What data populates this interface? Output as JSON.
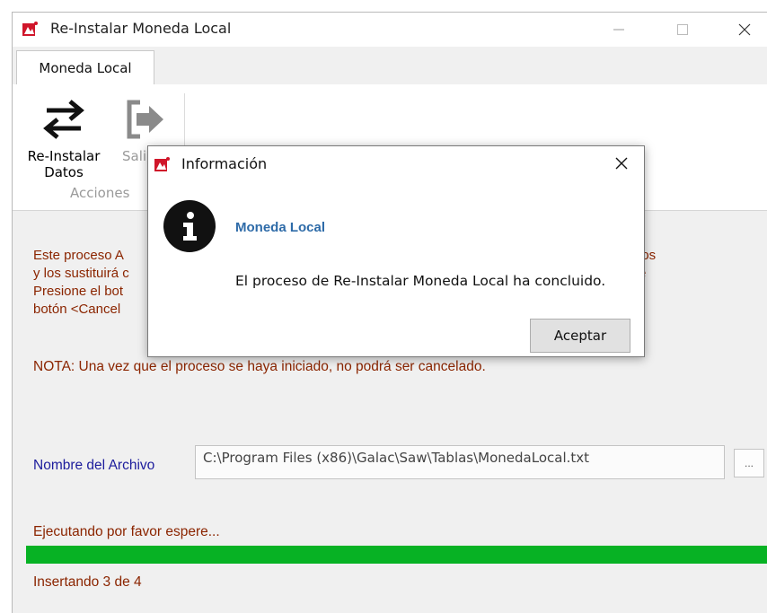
{
  "window": {
    "title": "Re-Instalar Moneda Local",
    "minimize_glyph": "—",
    "maximize_glyph": "☐",
    "close_glyph": "✕"
  },
  "tabs": [
    {
      "label": "Moneda Local",
      "active": true
    }
  ],
  "ribbon": {
    "buttons": [
      {
        "label_line1": "Re-Instalar",
        "label_line2": "Datos",
        "icon": "swap-arrows-icon",
        "enabled": true
      },
      {
        "label_line1": "Salir",
        "icon": "exit-icon",
        "enabled": false
      }
    ],
    "group_label": "Acciones"
  },
  "main": {
    "info_lines": [
      "Este proceso A",
      "y los sustituirá c",
      "Presione el bot",
      "botón <Cancel"
    ],
    "info_lines_right": [
      "dos",
      "re"
    ],
    "nota": "NOTA: Una vez que el proceso se haya iniciado, no podrá ser cancelado.",
    "file_label": "Nombre del Archivo",
    "file_value": "C:\\Program Files (x86)\\Galac\\Saw\\Tablas\\MonedaLocal.txt",
    "browse_label": "...",
    "status_text": "Ejecutando por favor espere...",
    "progress_fraction": 1.0,
    "progress_detail": "Insertando 3 de 4"
  },
  "dialog": {
    "title": "Información",
    "close_glyph": "✕",
    "heading": "Moneda Local",
    "message": "El proceso de Re-Instalar Moneda Local ha concluido.",
    "ok_label": "Aceptar",
    "icon": "info-icon"
  },
  "colors": {
    "accent_progress": "#07b224",
    "info_text": "#8b2500",
    "file_label": "#1c1c9c",
    "dialog_heading": "#2e6ba8"
  }
}
